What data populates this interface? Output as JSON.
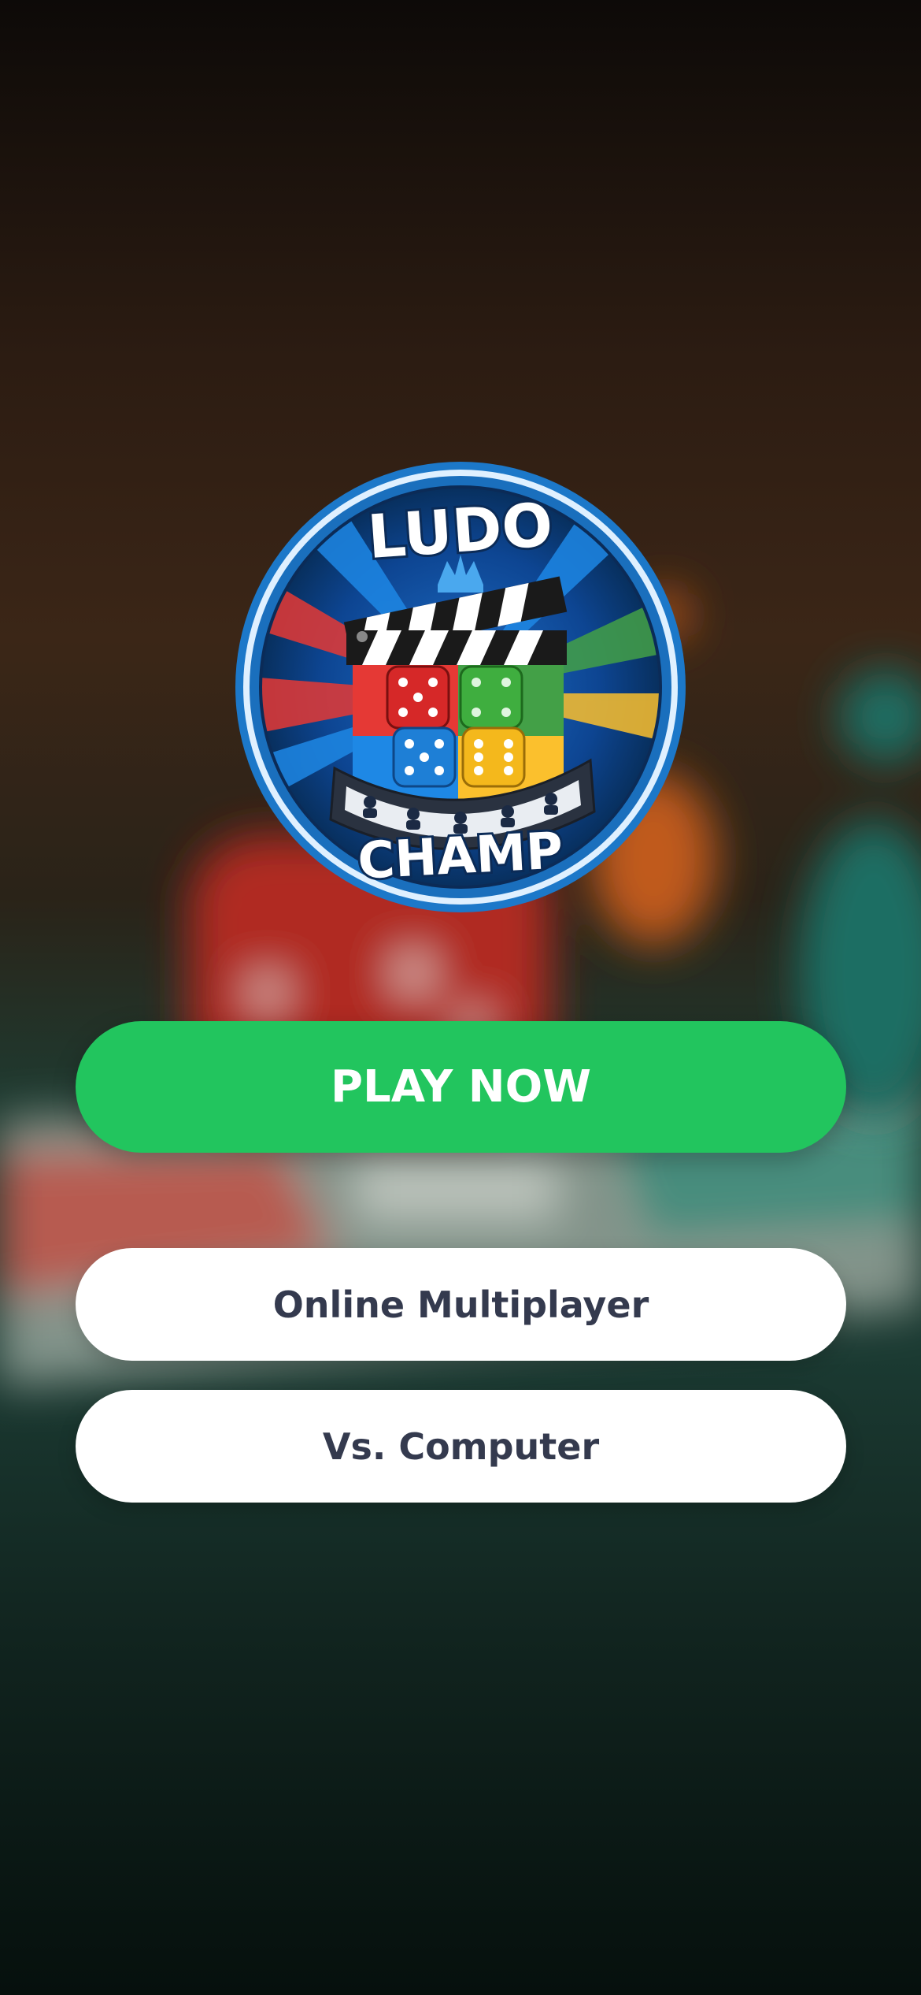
{
  "logo": {
    "top_text": "LUDO",
    "bottom_text": "CHAMP",
    "colors": {
      "ring": "#1c78c9",
      "inner": "#0b3c78",
      "red": "#e53935",
      "green": "#43a047",
      "blue": "#1e88e5",
      "yellow": "#fbc02d"
    }
  },
  "buttons": {
    "play_now": "PLAY NOW",
    "online_multiplayer": "Online Multiplayer",
    "vs_computer": "Vs. Computer"
  },
  "colors": {
    "primary_button": "#22c55e",
    "secondary_button": "#ffffff",
    "secondary_text": "#343a4e"
  },
  "icons": [
    "crown-icon",
    "clapperboard-icon",
    "dice-icon",
    "film-strip-icon"
  ]
}
